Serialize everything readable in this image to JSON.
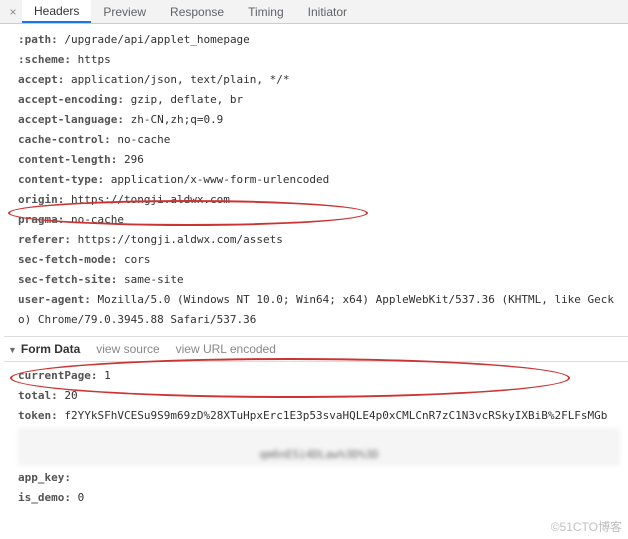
{
  "tabs": {
    "close_glyph": "×",
    "items": [
      "Headers",
      "Preview",
      "Response",
      "Timing",
      "Initiator"
    ],
    "active_index": 0
  },
  "request_headers": [
    {
      "key": ":path:",
      "value": "/upgrade/api/applet_homepage"
    },
    {
      "key": ":scheme:",
      "value": "https"
    },
    {
      "key": "accept:",
      "value": "application/json, text/plain, */*"
    },
    {
      "key": "accept-encoding:",
      "value": "gzip, deflate, br"
    },
    {
      "key": "accept-language:",
      "value": "zh-CN,zh;q=0.9"
    },
    {
      "key": "cache-control:",
      "value": "no-cache"
    },
    {
      "key": "content-length:",
      "value": "296"
    },
    {
      "key": "content-type:",
      "value": "application/x-www-form-urlencoded"
    },
    {
      "key": "origin:",
      "value": "https://tongji.aldwx.com"
    },
    {
      "key": "pragma:",
      "value": "no-cache"
    },
    {
      "key": "referer:",
      "value": "https://tongji.aldwx.com/assets"
    },
    {
      "key": "sec-fetch-mode:",
      "value": "cors"
    },
    {
      "key": "sec-fetch-site:",
      "value": "same-site"
    },
    {
      "key": "user-agent:",
      "value": "Mozilla/5.0 (Windows NT 10.0; Win64; x64) AppleWebKit/537.36 (KHTML, like Gecko) Chrome/79.0.3945.88 Safari/537.36"
    }
  ],
  "form_section": {
    "title": "Form Data",
    "triangle": "▼",
    "link_source": "view source",
    "link_urlenc": "view URL encoded"
  },
  "form_data": [
    {
      "key": "currentPage:",
      "value": "1"
    },
    {
      "key": "total:",
      "value": "20"
    },
    {
      "key": "token:",
      "value": "f2YYkSFhVCESu9S9m69zD%28XTuHpxErc1E3p53svaHQLE4p0xCMLCnR7zC1N3vcRSkyIXBiB%2FLFsMGb"
    },
    {
      "key": "app_key:",
      "value": ""
    },
    {
      "key": "is_demo:",
      "value": "0"
    }
  ],
  "blur_text": "qm6nESi4DLaw%3D%3D",
  "watermark": "©51CTO博客"
}
